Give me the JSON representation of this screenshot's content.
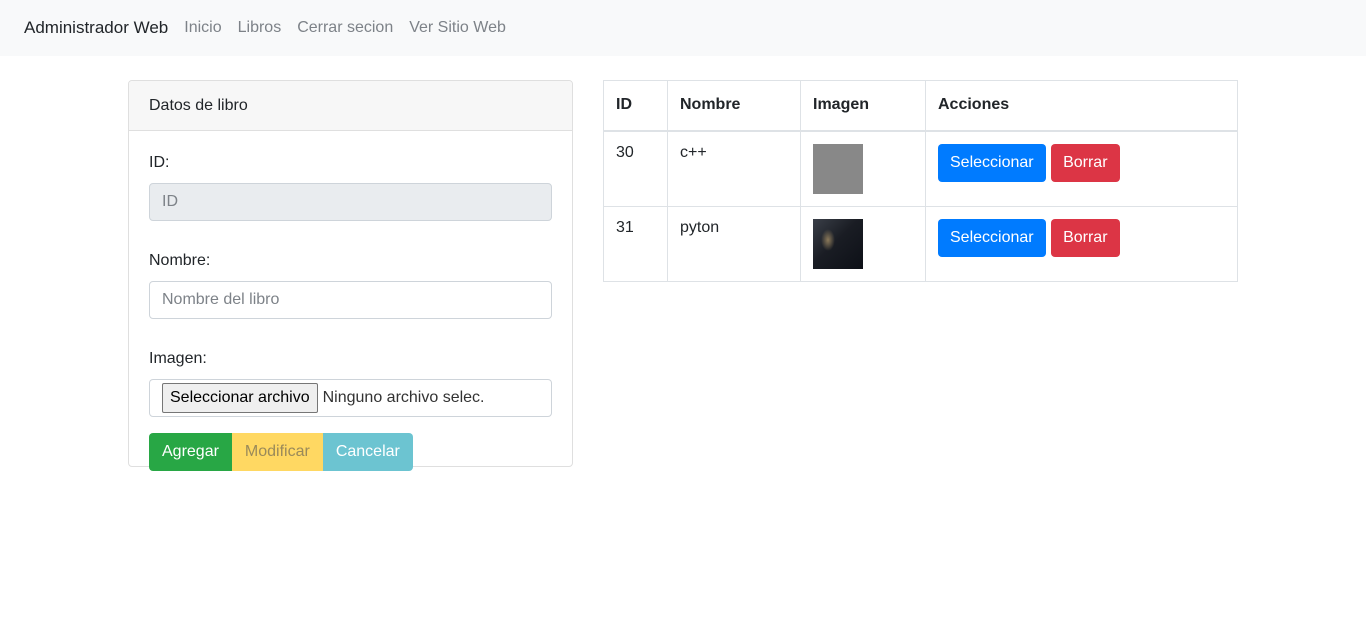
{
  "nav": {
    "brand": "Administrador Web",
    "links": [
      "Inicio",
      "Libros",
      "Cerrar secion",
      "Ver Sitio Web"
    ]
  },
  "form": {
    "header": "Datos de libro",
    "id_label": "ID:",
    "id_placeholder": "ID",
    "nombre_label": "Nombre:",
    "nombre_placeholder": "Nombre del libro",
    "imagen_label": "Imagen:",
    "file_button": "Seleccionar archivo",
    "file_status": "Ninguno archivo selec.",
    "buttons": {
      "agregar": "Agregar",
      "modificar": "Modificar",
      "cancelar": "Cancelar"
    }
  },
  "table": {
    "headers": [
      "ID",
      "Nombre",
      "Imagen",
      "Acciones"
    ],
    "rows": [
      {
        "id": "30",
        "nombre": "c++",
        "select_label": "Seleccionar",
        "delete_label": "Borrar"
      },
      {
        "id": "31",
        "nombre": "pyton",
        "select_label": "Seleccionar",
        "delete_label": "Borrar"
      }
    ]
  },
  "colors": {
    "success": "#28a745",
    "warning": "#ffd862",
    "info": "#6cc4d1",
    "primary": "#007bff",
    "danger": "#dc3545"
  }
}
